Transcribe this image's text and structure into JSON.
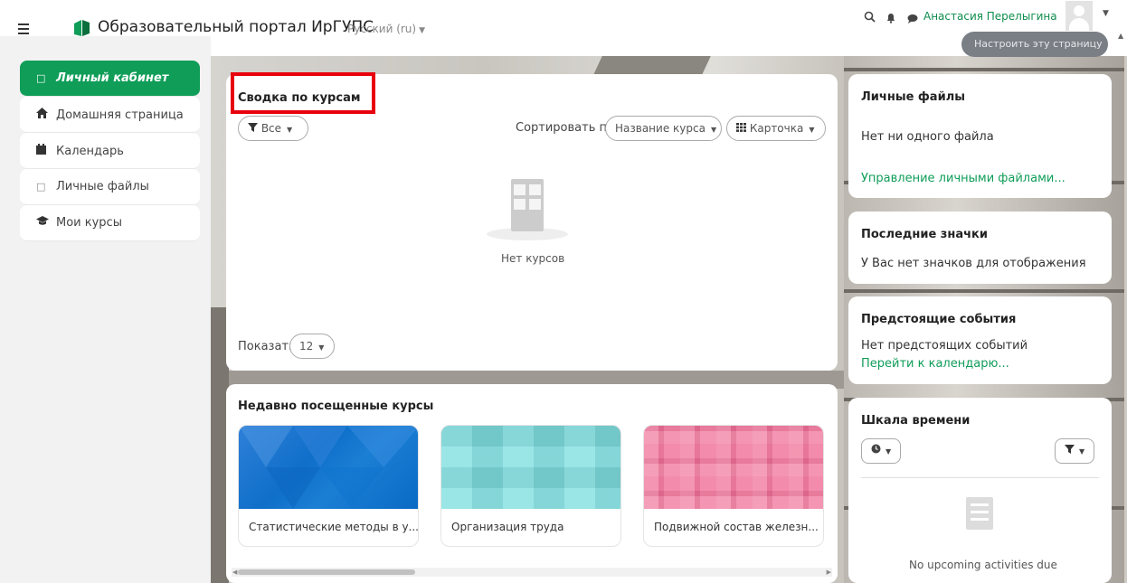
{
  "header": {
    "site_title": "Образовательный портал ИрГУПС",
    "language": "Русский (ru)",
    "user_name": "Анастасия Перелыгина",
    "edit_page_label": "Настроить эту страницу"
  },
  "sidebar": {
    "items": [
      {
        "label": "Личный кабинет",
        "icon": "dashboard-icon",
        "active": true
      },
      {
        "label": "Домашняя страница",
        "icon": "home-icon",
        "active": false
      },
      {
        "label": "Календарь",
        "icon": "calendar-icon",
        "active": false
      },
      {
        "label": "Личные файлы",
        "icon": "file-icon",
        "active": false
      },
      {
        "label": "Мои курсы",
        "icon": "graduation-cap-icon",
        "active": false
      }
    ]
  },
  "course_overview": {
    "title": "Сводка по курсам",
    "filter_label": "Все",
    "sort_label": "Сортировать по",
    "sort_value": "Название курса",
    "view_value": "Карточка",
    "empty_text": "Нет курсов",
    "show_label": "Показать",
    "show_value": "12"
  },
  "recent_courses": {
    "title": "Недавно посещенные курсы",
    "courses": [
      {
        "name": "Статистические методы в у..."
      },
      {
        "name": "Организация труда"
      },
      {
        "name": "Подвижной состав железн..."
      }
    ]
  },
  "private_files": {
    "title": "Личные файлы",
    "empty_text": "Нет ни одного файла",
    "manage_link": "Управление личными файлами..."
  },
  "badges": {
    "title": "Последние значки",
    "empty_text": "У Вас нет значков для отображения"
  },
  "upcoming_events": {
    "title": "Предстоящие события",
    "empty_text": "Нет предстоящих событий",
    "calendar_link": "Перейти к календарю..."
  },
  "timeline": {
    "title": "Шкала времени",
    "empty_text": "No upcoming activities due"
  },
  "colors": {
    "accent": "#0f9d58",
    "highlight_box": "#e8000c"
  }
}
